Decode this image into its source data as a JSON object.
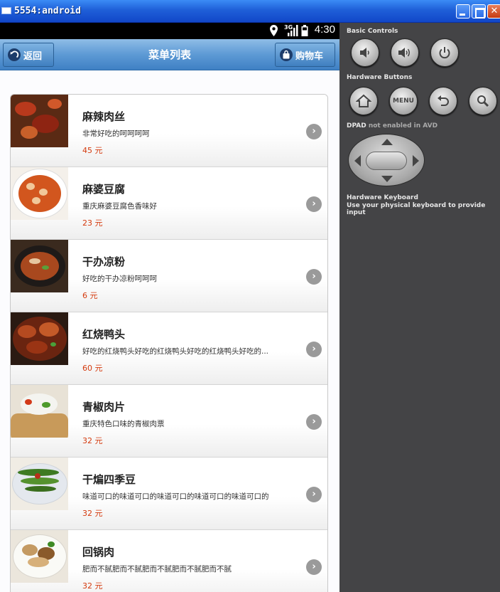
{
  "window": {
    "title": "5554:android",
    "minimize_glyph": "",
    "maximize_glyph": "",
    "close_glyph": "✕"
  },
  "statusbar": {
    "network": "3G",
    "time": "4:30",
    "icons": [
      "location-icon",
      "signal-icon",
      "battery-icon"
    ]
  },
  "appbar": {
    "back_label": "返回",
    "title": "菜单列表",
    "cart_label": "购物车"
  },
  "menu": [
    {
      "name": "麻辣肉丝",
      "desc": "非常好吃的呵呵呵呵",
      "price": "45 元"
    },
    {
      "name": "麻婆豆腐",
      "desc": "重庆麻婆豆腐色香味好",
      "price": "23 元"
    },
    {
      "name": "干办凉粉",
      "desc": "好吃的干办凉粉呵呵呵",
      "price": "6 元"
    },
    {
      "name": "红烧鸭头",
      "desc": "好吃的红烧鸭头好吃的红烧鸭头好吃的红烧鸭头好吃的...",
      "price": "60 元"
    },
    {
      "name": "青椒肉片",
      "desc": "重庆特色口味的青椒肉票",
      "price": "32 元"
    },
    {
      "name": "干煸四季豆",
      "desc": "味道可口的味道可口的味道可口的味道可口的味道可口的",
      "price": "32 元"
    },
    {
      "name": "回锅肉",
      "desc": "肥而不腻肥而不腻肥而不腻肥而不腻肥而不腻",
      "price": "32 元"
    }
  ],
  "panel": {
    "basic_controls": "Basic Controls",
    "hardware_buttons": "Hardware Buttons",
    "dpad_label": "DPAD",
    "dpad_note": "not enabled in AVD",
    "keyboard_title": "Hardware Keyboard",
    "keyboard_note": "Use your physical keyboard to provide input",
    "menu_button_label": "MENU"
  },
  "colors": {
    "price": "#d43a0e",
    "appbar": "#5d9ad5",
    "panel_bg": "#444446",
    "titlebar": "#1f5fd8"
  }
}
